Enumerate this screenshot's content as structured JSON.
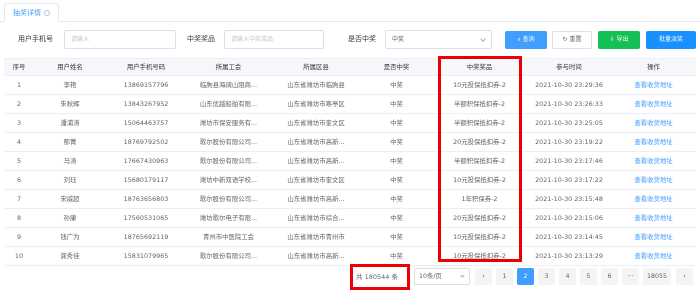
{
  "tab": {
    "label": "抽奖详情"
  },
  "filters": {
    "phone_label": "用户手机号",
    "phone_placeholder": "请输入",
    "prize_label": "中奖奖品",
    "prize_placeholder": "请输入中奖奖品",
    "win_label": "是否中奖",
    "win_value": "中奖",
    "search_label": "查询",
    "reset_label": "重置",
    "export_label": "导出",
    "batch_label": "批量派奖"
  },
  "table": {
    "headers": [
      "序号",
      "用户姓名",
      "用户手机号码",
      "所属工会",
      "所属区县",
      "是否中奖",
      "中奖奖品",
      "参与时间",
      "操作"
    ],
    "rows": [
      [
        "1",
        "李艳",
        "13869157796",
        "临朐县海阔山阻商...",
        "山东省潍坊市临朐县",
        "中奖",
        "10元投保抵扣券-2",
        "2021-10-30 23:29:36",
        "查看收货地址"
      ],
      [
        "2",
        "朱秋辉",
        "13843267952",
        "山东优越船舶有限...",
        "山东省潍坊市寒亭区",
        "中奖",
        "半额积保抵扣券-2",
        "2021-10-30 23:26:33",
        "查看收货地址"
      ],
      [
        "3",
        "潘浦涛",
        "15064463757",
        "潍坊市保安服务有...",
        "山东省潍坊市奎文区",
        "中奖",
        "半额积保抵扣券-2",
        "2021-10-30 23:25:05",
        "查看收货地址"
      ],
      [
        "4",
        "郁菁",
        "18769792502",
        "歌尔股份有限公司...",
        "山东省潍坊市高新...",
        "中奖",
        "20元投保抵扣券-2",
        "2021-10-30 23:19:22",
        "查看收货地址"
      ],
      [
        "5",
        "马涛",
        "17667430963",
        "歌尔股份有限公司...",
        "山东省潍坊市高新...",
        "中奖",
        "半额积保抵扣券-2",
        "2021-10-30 23:17:46",
        "查看收货地址"
      ],
      [
        "6",
        "刘珏",
        "15680179117",
        "潍坊中新双语学校...",
        "山东省潍坊市奎文区",
        "中奖",
        "10元投保抵扣券-2",
        "2021-10-30 23:17:22",
        "查看收货地址"
      ],
      [
        "7",
        "宋威超",
        "18763656803",
        "歌尔股份有限公司...",
        "山东省潍坊市高新...",
        "中奖",
        "1年积保券-2",
        "2021-10-30 23:15:48",
        "查看收货地址"
      ],
      [
        "8",
        "孙康",
        "17560531065",
        "潍坊歌尔电子有限...",
        "山东省潍坊市综合...",
        "中奖",
        "20元投保抵扣券-2",
        "2021-10-30 23:15:06",
        "查看收货地址"
      ],
      [
        "9",
        "钱广为",
        "18765692119",
        "青州市中医院工会",
        "山东省潍坊市青州市",
        "中奖",
        "10元投保抵扣券-2",
        "2021-10-30 23:14:45",
        "查看收货地址"
      ],
      [
        "10",
        "龚秀佳",
        "15831079965",
        "歌尔股份有限公司...",
        "山东省潍坊市高新...",
        "中奖",
        "10元投保抵扣券-2",
        "2021-10-30 23:13:29",
        "查看收货地址"
      ]
    ]
  },
  "pager": {
    "total": "共 180544 条",
    "page_size": "10条/页",
    "prev": "‹",
    "next": "›",
    "pages": [
      "1",
      "2",
      "3",
      "4",
      "5",
      "6",
      "···",
      "18055"
    ],
    "active_index": 1
  },
  "colors": {
    "accent": "#409eff",
    "success": "#13c054",
    "highlight": "#e00000"
  }
}
